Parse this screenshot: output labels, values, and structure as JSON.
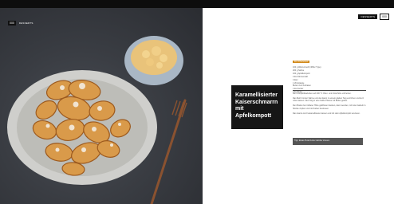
{
  "spread": {
    "left_page": {
      "page_number": "000",
      "section": "DESSERTS"
    },
    "right_page": {
      "page_number": "000",
      "section": "DESSERTS"
    }
  },
  "recipe": {
    "title_lines": [
      "Karamellisierter",
      "Kaiserschmarrn",
      "mit Apfelkompott"
    ],
    "ingredients_label": "Für 2 Personen",
    "ingredients": [
      "100 g Weizenmehl (405er Type)",
      "200 g Sahne",
      "100 g Apfelkompott",
      "4 EL Zitronensaft",
      "4 Eier",
      "1 Zimtstange",
      "Butter zum Anbraten",
      "1 EL Zucker",
      "2 EL Butter"
    ],
    "paragraphs": [
      "Den Kompottbackofen auf 200 °C Ober- und Unterhitze vorheizen.",
      "Das Mehl mit der Sahne und den Eiern zu einem glatten Teig verrühren und kurz ruhen lassen. Den Teig in eine heiße Pfanne mit Butter geben.",
      "Den Boden bei mittlerer Hitze goldbraun backen, dann wenden, mit zwei Gabeln in Stücke zupfen und mit Zucker bestreuen.",
      "Das Ganze kurz karamellisieren lassen und mit dem Apfelkompott servieren."
    ],
    "tip": "Tipp: Etwas Puderzucker darüber streuen."
  },
  "colors": {
    "accent": "#d28a1b",
    "title_block": "#161616",
    "photo_background": "#3a3d43"
  },
  "icons": {
    "food_photo": "kaiserschmarrn-plate-with-fork-and-apple-compote-bowl"
  }
}
